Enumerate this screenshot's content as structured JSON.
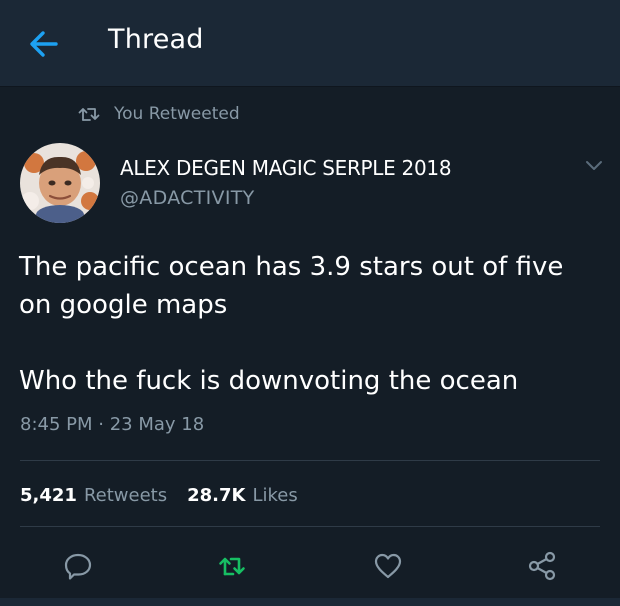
{
  "header": {
    "title": "Thread",
    "back_icon": "arrow-left-icon"
  },
  "retweet_context": {
    "label": "You Retweeted",
    "icon": "retweet-icon"
  },
  "tweet": {
    "author": {
      "display_name": "ALEX DEGEN MAGIC SERPLE 2018",
      "handle": "@ADACTIVITY"
    },
    "text": "The pacific ocean has 3.9 stars out of five on google maps\n\nWho the fuck is downvoting the ocean",
    "timestamp": "8:45 PM · 23 May 18",
    "stats": {
      "retweets_count": "5,421",
      "retweets_label": "Retweets",
      "likes_count": "28.7K",
      "likes_label": "Likes"
    }
  },
  "actions": [
    "reply-icon",
    "retweet-icon",
    "like-heart-icon",
    "share-icon"
  ],
  "colors": {
    "background": "#141d26",
    "header": "#1b2836",
    "secondary_text": "#8899a6",
    "accent_blue": "#1da1f2",
    "retweet_green": "#17bf63"
  }
}
